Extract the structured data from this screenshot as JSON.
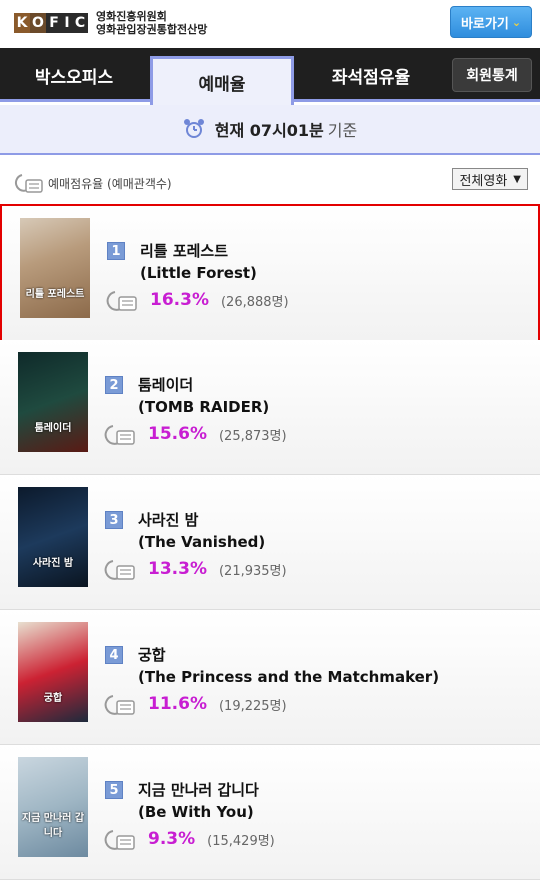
{
  "header": {
    "logo_letters": [
      "K",
      "O",
      "F",
      "I",
      "C"
    ],
    "logo_line1": "영화진흥위원회",
    "logo_line2": "영화관입장권통합전산망",
    "goto_label": "바로가기"
  },
  "tabs": [
    {
      "label": "박스오피스",
      "active": false
    },
    {
      "label": "예매율",
      "active": true
    },
    {
      "label": "좌석점유율",
      "active": false
    },
    {
      "label": "회원통계",
      "active": false
    }
  ],
  "timebar": {
    "prefix": "현재",
    "time": "07시01분",
    "suffix": "기준"
  },
  "filter": {
    "legend": "예매점유율 (예매관객수)",
    "select_value": "전체영화"
  },
  "colors": {
    "accent": "#8e9be6",
    "rate": "#c81ed2",
    "rank_bg": "#7a9bd6",
    "selected_border": "#e30000"
  },
  "movies": [
    {
      "rank": "1",
      "title_ko": "리틀 포레스트",
      "title_en": "(Little Forest)",
      "share": "16.3%",
      "count": "(26,888명)",
      "poster_text": "리틀 포레스트"
    },
    {
      "rank": "2",
      "title_ko": "툼레이더",
      "title_en": "(TOMB RAIDER)",
      "share": "15.6%",
      "count": "(25,873명)",
      "poster_text": "툼레이더"
    },
    {
      "rank": "3",
      "title_ko": "사라진 밤",
      "title_en": "(The Vanished)",
      "share": "13.3%",
      "count": "(21,935명)",
      "poster_text": "사라진 밤"
    },
    {
      "rank": "4",
      "title_ko": "궁합",
      "title_en": "(The Princess and the Matchmaker)",
      "share": "11.6%",
      "count": "(19,225명)",
      "poster_text": "궁합"
    },
    {
      "rank": "5",
      "title_ko": "지금 만나러 갑니다",
      "title_en": "(Be With You)",
      "share": "9.3%",
      "count": "(15,429명)",
      "poster_text": "지금 만나러 갑니다"
    }
  ]
}
